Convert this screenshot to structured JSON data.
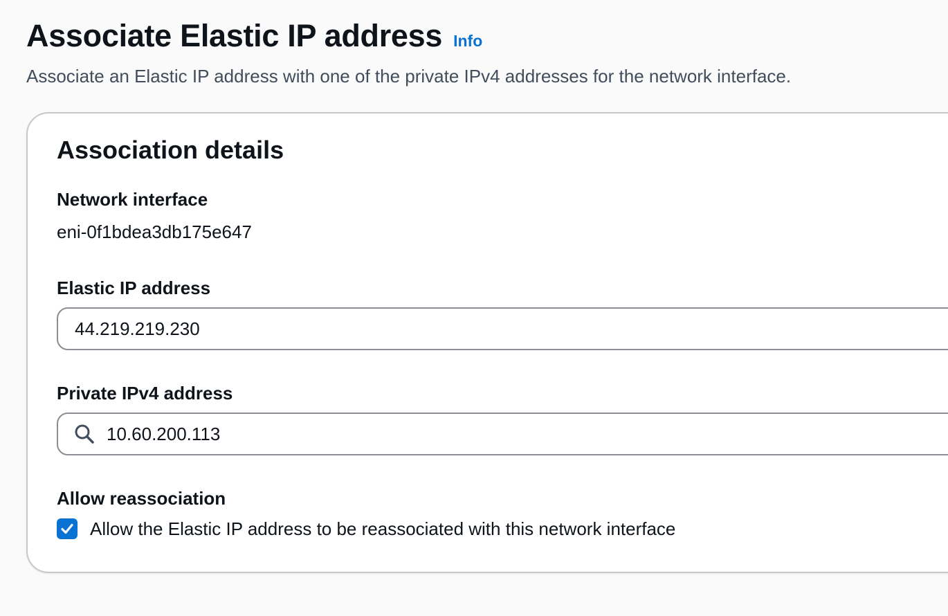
{
  "header": {
    "title": "Associate Elastic IP address",
    "info_label": "Info",
    "description": "Associate an Elastic IP address with one of the private IPv4 addresses for the network interface."
  },
  "association": {
    "title": "Association details",
    "network_interface": {
      "label": "Network interface",
      "value": "eni-0f1bdea3db175e647"
    },
    "elastic_ip": {
      "label": "Elastic IP address",
      "value": "44.219.219.230"
    },
    "private_ipv4": {
      "label": "Private IPv4 address",
      "value": "10.60.200.113",
      "icon": "search-icon"
    },
    "reassociation": {
      "label": "Allow reassociation",
      "checkbox_label": "Allow the Elastic IP address to be reassociated with this network interface",
      "checked": true
    }
  },
  "colors": {
    "accent": "#0972d3",
    "text": "#0f141a",
    "secondary_text": "#414d5c",
    "border": "#8c8c94"
  }
}
